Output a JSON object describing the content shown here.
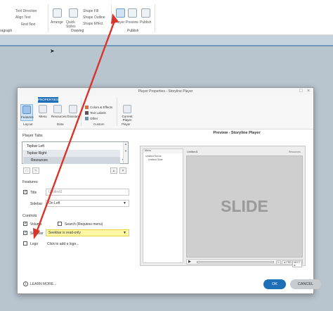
{
  "ribbon": {
    "text_direction": "Text Direction",
    "align_text": "Align Text",
    "find_text": "Find Text",
    "paragraph_label": "ragraph",
    "arrange": "Arrange",
    "quick_styles": "Quick Styles",
    "shape_fill": "Shape Fill",
    "shape_outline": "Shape Outline",
    "shape_effect": "Shape Effect",
    "drawing_label": "Drawing",
    "player": "Player",
    "preview": "Preview",
    "publish": "Publish",
    "publish_label": "Publish"
  },
  "dialog": {
    "title": "Player Properties - Storyline Player",
    "tab_properties": "PROPERTIES",
    "buttons": {
      "features": "Features",
      "menu": "Menu",
      "resources": "Resources",
      "glossary": "Glossary",
      "colors_effects": "Colors & Effects",
      "text_labels": "Text Labels",
      "other": "Other",
      "current_player": "Current Player"
    },
    "groups": {
      "layout": "Layout",
      "data": "Data",
      "custom": "Custom",
      "player": "Player"
    },
    "player_tabs_heading": "Player Tabs",
    "player_tabs": [
      "Topbar Left",
      "Topbar Right",
      "Resources"
    ],
    "features_heading": "Features",
    "title_label": "Title",
    "title_value": "Untitled1",
    "sidebar_label": "Sidebar",
    "sidebar_value": "On Left",
    "controls_heading": "Controls",
    "volume_label": "Volume",
    "search_label": "Search (Requires menu)",
    "seekbar_label": "Seekbar",
    "seekbar_value": "Seekbar is read-only",
    "logo_label": "Logo",
    "logo_link": "Click to add a logo...",
    "learn_more": "LEARN MORE...",
    "ok": "OK",
    "cancel": "CANCEL"
  },
  "preview": {
    "heading": "Preview - Storyline Player",
    "menu_header": "Menu",
    "menu_items": [
      "Untitled Scene",
      "Untitled Slide"
    ],
    "slide_title": "Untitled1",
    "resources": "Resources",
    "slide_text": "SLIDE",
    "prev": "◄ PREV",
    "next": "NEXT ►"
  },
  "colors": {
    "accent": "#1f6eb8",
    "seekbar_highlight": "#fef7a6",
    "arrow": "#d9342b"
  }
}
